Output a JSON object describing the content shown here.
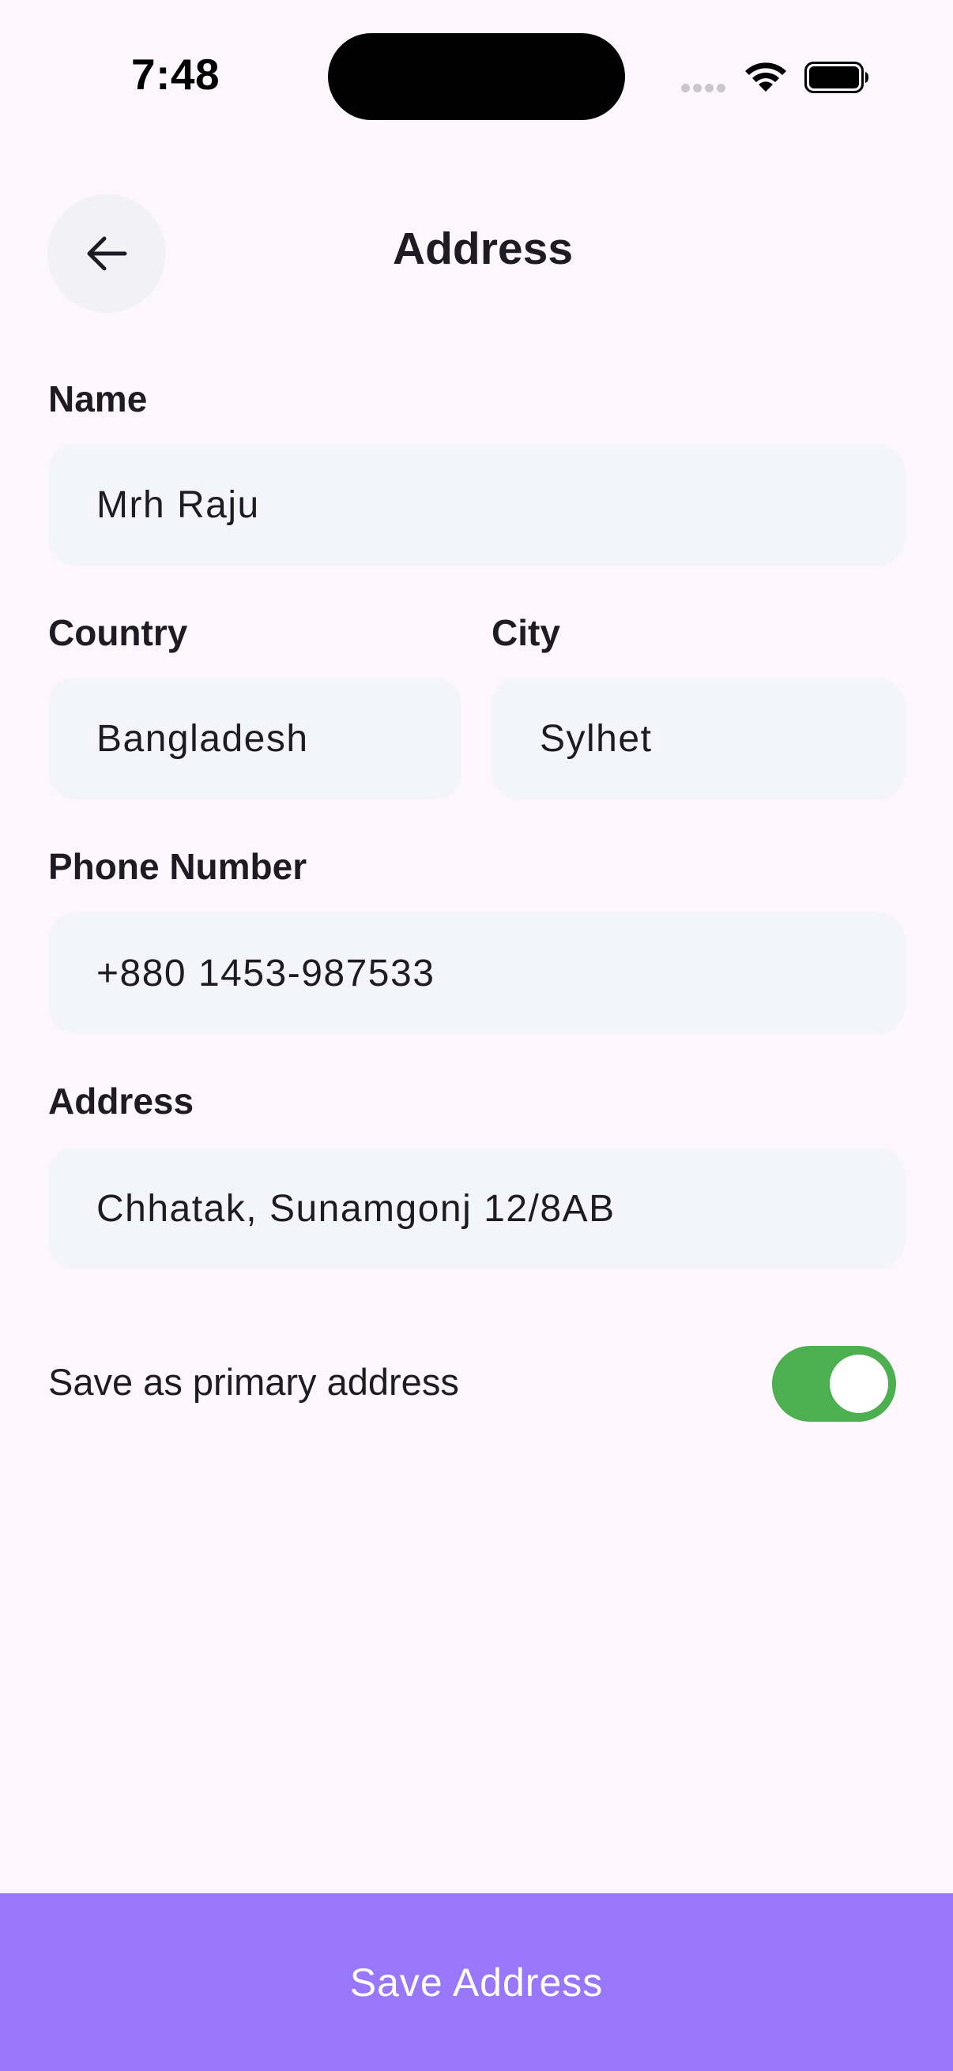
{
  "status_bar": {
    "time": "7:48",
    "icons": [
      "cellular-signal-icon",
      "wifi-icon",
      "battery-icon"
    ]
  },
  "header": {
    "back_icon": "arrow-left-icon",
    "title": "Address"
  },
  "form": {
    "name": {
      "label": "Name",
      "value": "Mrh Raju"
    },
    "country": {
      "label": "Country",
      "value": "Bangladesh"
    },
    "city": {
      "label": "City",
      "value": "Sylhet"
    },
    "phone": {
      "label": "Phone Number",
      "value": "+880 1453-987533"
    },
    "address": {
      "label": "Address",
      "value": "Chhatak, Sunamgonj 12/8AB"
    },
    "primary_toggle": {
      "label": "Save as primary address",
      "on": true
    }
  },
  "footer": {
    "save_label": "Save Address"
  },
  "colors": {
    "background": "#FDF7FD",
    "field_background": "#F4F5FA",
    "toggle_on": "#4CAF50",
    "primary_button": "#9977FA"
  }
}
